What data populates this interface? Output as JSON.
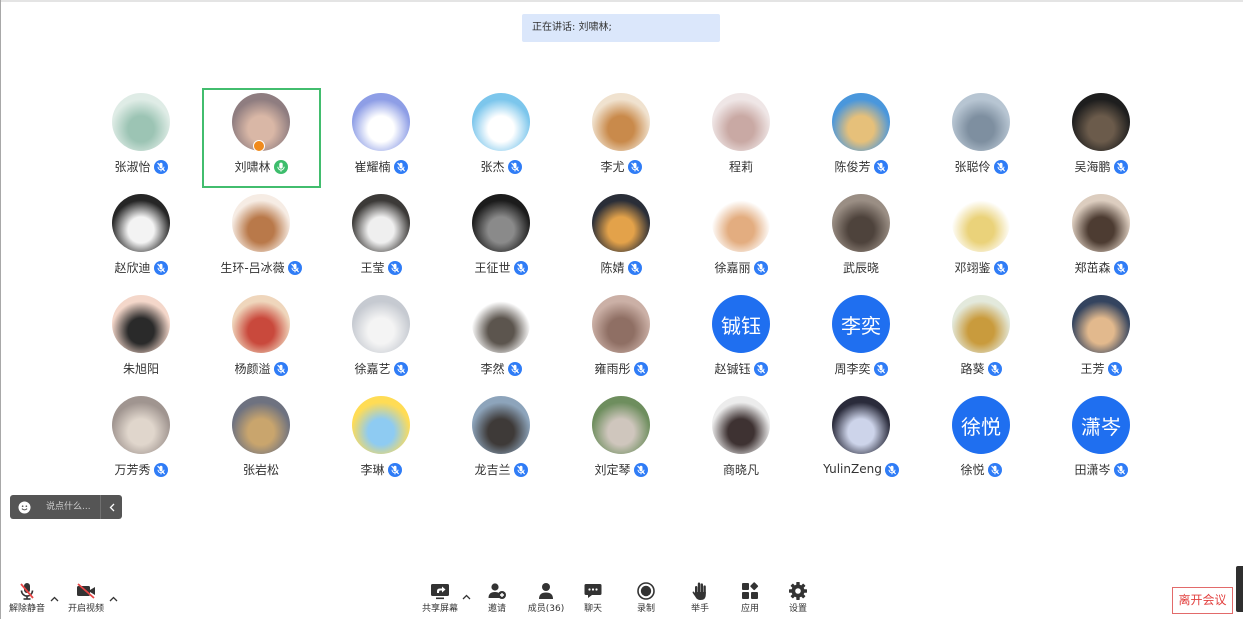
{
  "speaking_banner": "正在讲话: 刘啸林;",
  "participants": [
    {
      "name": "张淑怡",
      "mic_icon": "mic-muted-icon",
      "avatar_colors": [
        "#dfece6",
        "#9cc4b4"
      ]
    },
    {
      "name": "刘啸林",
      "mic_icon": "mic-speaking-icon",
      "active": true,
      "badge_icon": "host-icon",
      "avatar_colors": [
        "#8f7d80",
        "#d9b7a6"
      ]
    },
    {
      "name": "崔耀楠",
      "mic_icon": "mic-muted-icon",
      "avatar_colors": [
        "#8e9ee6",
        "#ffffff"
      ]
    },
    {
      "name": "张杰",
      "mic_icon": "mic-muted-icon",
      "avatar_colors": [
        "#7cc6ec",
        "#ffffff"
      ]
    },
    {
      "name": "李尤",
      "mic_icon": "mic-muted-icon",
      "avatar_colors": [
        "#f0e2cf",
        "#c98a4b"
      ]
    },
    {
      "name": "程莉",
      "mic_icon": null,
      "avatar_colors": [
        "#efe6e6",
        "#c9a9a4"
      ]
    },
    {
      "name": "陈俊芳",
      "mic_icon": "mic-muted-icon",
      "avatar_colors": [
        "#4a97dc",
        "#e6c07a"
      ]
    },
    {
      "name": "张聪伶",
      "mic_icon": "mic-muted-icon",
      "avatar_colors": [
        "#b7c5d2",
        "#7e8fa0"
      ]
    },
    {
      "name": "吴海鹏",
      "mic_icon": "mic-muted-icon",
      "avatar_colors": [
        "#1e1e1e",
        "#6b5b4b"
      ]
    },
    {
      "name": "赵欣迪",
      "mic_icon": "mic-muted-icon",
      "avatar_colors": [
        "#262626",
        "#f3f3f3"
      ]
    },
    {
      "name": "生环-吕冰薇",
      "mic_icon": "mic-muted-icon",
      "avatar_colors": [
        "#f6ece4",
        "#b9794a"
      ]
    },
    {
      "name": "王莹",
      "mic_icon": "mic-muted-icon",
      "avatar_colors": [
        "#3c3a38",
        "#efefef"
      ]
    },
    {
      "name": "王征世",
      "mic_icon": "mic-muted-icon",
      "avatar_colors": [
        "#1c1c1c",
        "#8a8a8a"
      ]
    },
    {
      "name": "陈婧",
      "mic_icon": "mic-muted-icon",
      "avatar_colors": [
        "#2a2e38",
        "#e3a24a"
      ]
    },
    {
      "name": "徐嘉丽",
      "mic_icon": "mic-muted-icon",
      "avatar_colors": [
        "#ffffff",
        "#e3ad80"
      ]
    },
    {
      "name": "武辰晓",
      "mic_icon": null,
      "avatar_colors": [
        "#9a8e84",
        "#4e433c"
      ]
    },
    {
      "name": "邓翊鉴",
      "mic_icon": "mic-muted-icon",
      "avatar_colors": [
        "#ffffff",
        "#ead27a"
      ]
    },
    {
      "name": "郑茁森",
      "mic_icon": "mic-muted-icon",
      "avatar_colors": [
        "#dccdbf",
        "#4d3c32"
      ]
    },
    {
      "name": "朱旭阳",
      "mic_icon": null,
      "avatar_colors": [
        "#f4d7ca",
        "#2a2a2a"
      ]
    },
    {
      "name": "杨颜溢",
      "mic_icon": "mic-muted-icon",
      "avatar_colors": [
        "#efd6bc",
        "#c9493c"
      ]
    },
    {
      "name": "徐嘉艺",
      "mic_icon": "mic-muted-icon",
      "avatar_colors": [
        "#c6cad1",
        "#f4f4f4"
      ]
    },
    {
      "name": "李然",
      "mic_icon": "mic-muted-icon",
      "avatar_colors": [
        "#ffffff",
        "#5c554e"
      ]
    },
    {
      "name": "雍雨彤",
      "mic_icon": "mic-muted-icon",
      "avatar_colors": [
        "#cbb0a6",
        "#8f6f64"
      ]
    },
    {
      "name": "赵铖钰",
      "mic_icon": "mic-muted-icon",
      "avatar_text": "铖钰",
      "avatar_colors": [
        "#1f6ff0"
      ]
    },
    {
      "name": "周李奕",
      "mic_icon": "mic-muted-icon",
      "avatar_text": "李奕",
      "avatar_colors": [
        "#1f6ff0"
      ]
    },
    {
      "name": "路葵",
      "mic_icon": "mic-muted-icon",
      "avatar_colors": [
        "#e3e9dc",
        "#c99b3d"
      ]
    },
    {
      "name": "王芳",
      "mic_icon": "mic-muted-icon",
      "avatar_colors": [
        "#34445f",
        "#e2b98d"
      ]
    },
    {
      "name": "万芳秀",
      "mic_icon": "mic-muted-icon",
      "avatar_colors": [
        "#a09590",
        "#e0d6cc"
      ]
    },
    {
      "name": "张岩松",
      "mic_icon": null,
      "avatar_colors": [
        "#6e7280",
        "#c9a56d"
      ]
    },
    {
      "name": "李琳",
      "mic_icon": "mic-muted-icon",
      "avatar_colors": [
        "#ffdc55",
        "#8ecbf2"
      ]
    },
    {
      "name": "龙吉兰",
      "mic_icon": "mic-muted-icon",
      "avatar_colors": [
        "#8da4bb",
        "#3e3a38"
      ]
    },
    {
      "name": "刘定琴",
      "mic_icon": "mic-muted-icon",
      "avatar_colors": [
        "#6e8e5e",
        "#cfc6bd"
      ]
    },
    {
      "name": "商晓凡",
      "mic_icon": null,
      "avatar_colors": [
        "#ececec",
        "#3e3232"
      ]
    },
    {
      "name": "YulinZeng",
      "mic_icon": "mic-muted-icon",
      "avatar_colors": [
        "#2a2b3b",
        "#cdd4ea"
      ]
    },
    {
      "name": "徐悦",
      "mic_icon": "mic-muted-icon",
      "avatar_text": "徐悦",
      "avatar_colors": [
        "#1f6ff0"
      ]
    },
    {
      "name": "田潇岑",
      "mic_icon": "mic-muted-icon",
      "avatar_text": "潇岑",
      "avatar_colors": [
        "#1f6ff0"
      ]
    }
  ],
  "chat_input": {
    "placeholder": "说点什么..."
  },
  "toolbar": {
    "unmute": "解除静音",
    "start_video": "开启视频",
    "share_screen": "共享屏幕",
    "invite": "邀请",
    "members": "成员(36)",
    "chat": "聊天",
    "record": "录制",
    "raise_hand": "举手",
    "apps": "应用",
    "settings": "设置",
    "leave": "离开会议"
  },
  "colors": {
    "mic_muted": "#2f7cf6",
    "speaking": "#3dbd6c",
    "leave": "#e2403f",
    "banner_bg": "#dbe7fb",
    "mute_slash": "#e94545"
  }
}
